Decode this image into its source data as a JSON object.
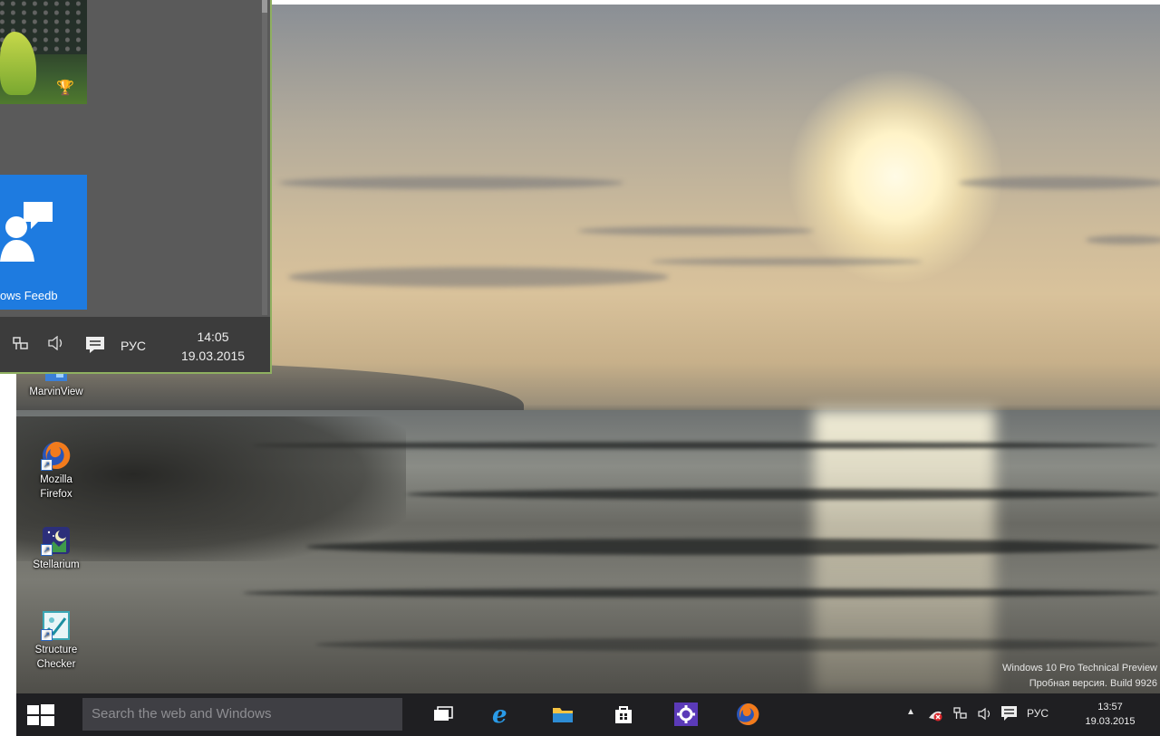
{
  "start_menu": {
    "feedback_tile_label": "ows Feedb",
    "language": "РУС",
    "time": "14:05",
    "date": "19.03.2015"
  },
  "desktop_icons": [
    {
      "label_line1": "MarvinView",
      "label_line2": ""
    },
    {
      "label_line1": "Mozilla",
      "label_line2": "Firefox"
    },
    {
      "label_line1": "Stellarium",
      "label_line2": ""
    },
    {
      "label_line1": "Structure",
      "label_line2": "Checker"
    }
  ],
  "watermark": {
    "line1": "Windows 10 Pro Technical Preview",
    "line2": "Пробная версия. Build 9926"
  },
  "taskbar": {
    "search_placeholder": "Search the web and Windows",
    "language": "РУС",
    "time": "13:57",
    "date": "19.03.2015"
  },
  "colors": {
    "taskbar": "#1f1f22",
    "start_accent_border": "#8fb060",
    "feedback_tile": "#1e7be0",
    "search_box": "#3f3f44"
  }
}
